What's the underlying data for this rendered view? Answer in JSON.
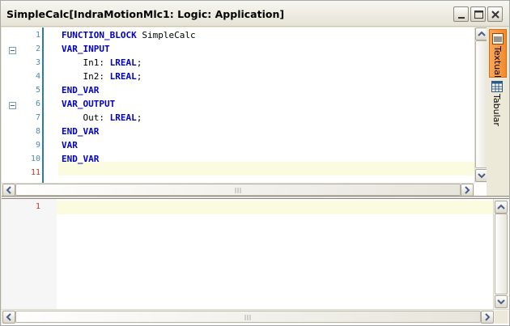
{
  "window": {
    "title": "SimpleCalc[IndraMotionMlc1: Logic: Application]",
    "controls": [
      "minimize",
      "maximize",
      "close"
    ]
  },
  "editor": {
    "lines": [
      {
        "num": "1",
        "indent": "",
        "tokens": [
          {
            "t": "FUNCTION_BLOCK",
            "kw": true
          },
          {
            "t": " SimpleCalc",
            "kw": false
          }
        ]
      },
      {
        "num": "2",
        "indent": "",
        "fold": true,
        "tokens": [
          {
            "t": "VAR_INPUT",
            "kw": true
          }
        ]
      },
      {
        "num": "3",
        "indent": "    ",
        "tokens": [
          {
            "t": "In1: ",
            "kw": false
          },
          {
            "t": "LREAL",
            "kw": true
          },
          {
            "t": ";",
            "kw": false
          }
        ]
      },
      {
        "num": "4",
        "indent": "    ",
        "tokens": [
          {
            "t": "In2: ",
            "kw": false
          },
          {
            "t": "LREAL",
            "kw": true
          },
          {
            "t": ";",
            "kw": false
          }
        ]
      },
      {
        "num": "5",
        "indent": "",
        "tokens": [
          {
            "t": "END_VAR",
            "kw": true
          }
        ]
      },
      {
        "num": "6",
        "indent": "",
        "fold": true,
        "tokens": [
          {
            "t": "VAR_OUTPUT",
            "kw": true
          }
        ]
      },
      {
        "num": "7",
        "indent": "    ",
        "tokens": [
          {
            "t": "Out: ",
            "kw": false
          },
          {
            "t": "LREAL",
            "kw": true
          },
          {
            "t": ";",
            "kw": false
          }
        ]
      },
      {
        "num": "8",
        "indent": "",
        "tokens": [
          {
            "t": "END_VAR",
            "kw": true
          }
        ]
      },
      {
        "num": "9",
        "indent": "",
        "tokens": [
          {
            "t": "VAR",
            "kw": true
          }
        ]
      },
      {
        "num": "10",
        "indent": "",
        "tokens": [
          {
            "t": "END_VAR",
            "kw": true
          }
        ]
      },
      {
        "num": "11",
        "indent": "",
        "current": true,
        "tokens": []
      }
    ]
  },
  "side_tabs": [
    {
      "label": "Textual",
      "active": true,
      "icon": "textual-icon"
    },
    {
      "label": "Tabular",
      "active": false,
      "icon": "table-icon"
    }
  ],
  "body_editor": {
    "lines": [
      {
        "num": "1",
        "current": true
      }
    ]
  },
  "colors": {
    "keyword": "#0000cc",
    "line_number": "#4a8ca8",
    "current_line_number": "#c0392b",
    "active_tab": "#f28b2f",
    "current_line_bg": "#fbfbe0"
  }
}
